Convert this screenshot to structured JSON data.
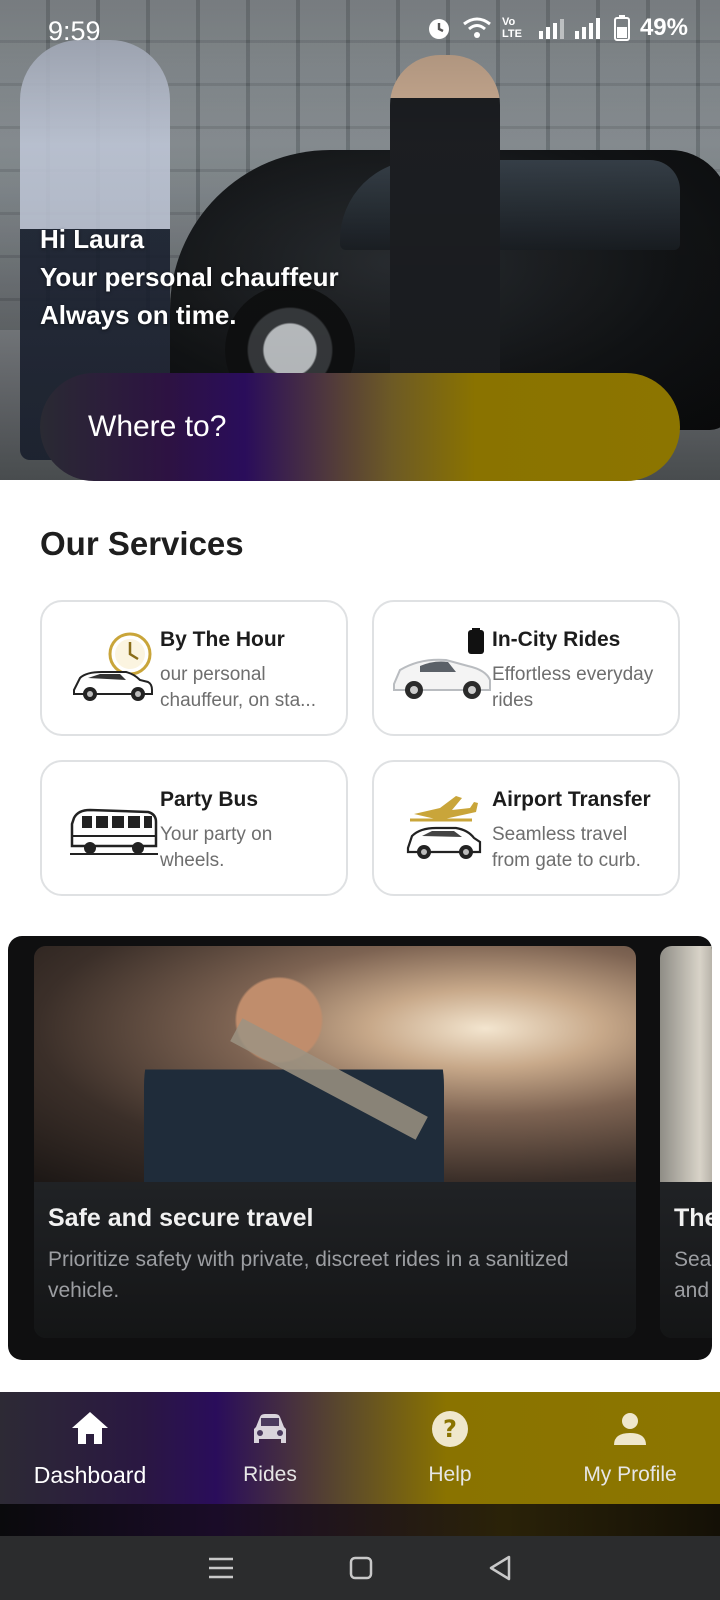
{
  "status_bar": {
    "time": "9:59",
    "network_label": "Vo LTE",
    "battery": "49%"
  },
  "hero": {
    "greeting": "Hi Laura",
    "tagline_line1": "Your personal chauffeur",
    "tagline_line2": "Always on time.",
    "search_label": "Where to?"
  },
  "services": {
    "title": "Our Services",
    "items": [
      {
        "name": "By The Hour",
        "description": "our personal chauffeur, on sta...",
        "icon": "clock-car-icon"
      },
      {
        "name": "In-City Rides",
        "description": "Effortless everyday rides",
        "icon": "city-car-icon"
      },
      {
        "name": "Party Bus",
        "description": "Your party on wheels.",
        "icon": "bus-icon"
      },
      {
        "name": "Airport Transfer",
        "description": "Seamless travel from gate to curb.",
        "icon": "plane-car-icon"
      }
    ]
  },
  "carousel": {
    "slides": [
      {
        "title": "Safe and secure travel",
        "description": "Prioritize safety with private, discreet rides in a sanitized vehicle."
      },
      {
        "title": "The",
        "description": "Sea and"
      }
    ]
  },
  "bottom_nav": {
    "items": [
      {
        "label": "Dashboard",
        "icon": "home-icon",
        "active": true
      },
      {
        "label": "Rides",
        "icon": "car-icon",
        "active": false
      },
      {
        "label": "Help",
        "icon": "help-icon",
        "active": false
      },
      {
        "label": "My Profile",
        "icon": "person-icon",
        "active": false
      }
    ]
  },
  "colors": {
    "accent_purple": "#2a0d5b",
    "accent_gold": "#8c7500",
    "icon_gold": "#c9a53a"
  }
}
